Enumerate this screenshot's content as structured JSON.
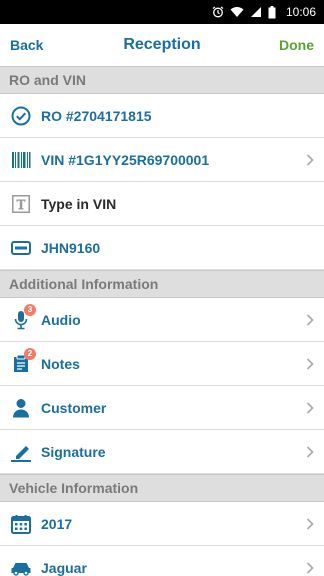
{
  "status_bar": {
    "time": "10:06"
  },
  "nav": {
    "back_label": "Back",
    "title": "Reception",
    "done_label": "Done"
  },
  "sections": {
    "ro_vin": {
      "title": "RO and VIN",
      "ro": {
        "label": "RO #2704171815",
        "icon": "check-circle-icon"
      },
      "vin": {
        "label": "VIN #1G1YY25R69700001",
        "icon": "barcode-icon"
      },
      "type_vin": {
        "label": "Type in VIN",
        "icon": "text-t-icon"
      },
      "plate": {
        "label": "JHN9160",
        "icon": "license-plate-icon"
      }
    },
    "additional": {
      "title": "Additional Information",
      "audio": {
        "label": "Audio",
        "badge": "3",
        "icon": "microphone-icon"
      },
      "notes": {
        "label": "Notes",
        "badge": "2",
        "icon": "notes-icon"
      },
      "customer": {
        "label": "Customer",
        "icon": "person-icon"
      },
      "signature": {
        "label": "Signature",
        "icon": "pen-icon"
      }
    },
    "vehicle": {
      "title": "Vehicle Information",
      "year": {
        "label": "2017",
        "icon": "calendar-icon"
      },
      "make": {
        "label": "Jaguar",
        "icon": "car-icon"
      }
    }
  },
  "colors": {
    "accent": "#1a6fa0",
    "done": "#5aa332",
    "badge": "#f07c6a",
    "section_bg": "#dedede"
  }
}
